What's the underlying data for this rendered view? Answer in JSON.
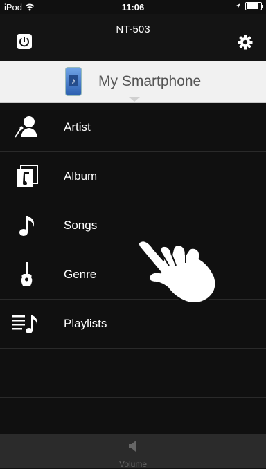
{
  "status_bar": {
    "carrier": "iPod",
    "time": "11:06",
    "battery_level": 0.8
  },
  "header": {
    "title": "NT-503",
    "power_icon": "power-icon",
    "settings_icon": "gear-icon"
  },
  "source": {
    "label": "My Smartphone",
    "icon": "smartphone-music-icon"
  },
  "menu": {
    "items": [
      {
        "label": "Artist",
        "icon": "artist-icon"
      },
      {
        "label": "Album",
        "icon": "album-icon"
      },
      {
        "label": "Songs",
        "icon": "music-note-icon"
      },
      {
        "label": "Genre",
        "icon": "guitar-icon"
      },
      {
        "label": "Playlists",
        "icon": "playlist-icon"
      }
    ]
  },
  "tab_bar": {
    "volume_label": "Volume",
    "volume_icon": "speaker-icon"
  },
  "colors": {
    "background": "#101010",
    "source_bar": "#f1f1f1",
    "tab_bar": "#2b2b2b"
  }
}
